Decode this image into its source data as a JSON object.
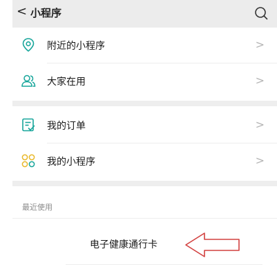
{
  "header": {
    "back_glyph": "<",
    "title": "小程序",
    "search_icon": "search-icon"
  },
  "list_group_1": [
    {
      "label": "附近的小程序",
      "icon": "location-pin-icon",
      "chevron": ">"
    },
    {
      "label": "大家在用",
      "icon": "people-icon",
      "chevron": ">"
    }
  ],
  "list_group_2": [
    {
      "label": "我的订单",
      "icon": "order-icon",
      "chevron": ">"
    },
    {
      "label": "我的小程序",
      "icon": "mini-program-icon",
      "chevron": ">"
    }
  ],
  "recent": {
    "section_label": "最近使用",
    "items": [
      {
        "label": "电子健康通行卡"
      }
    ]
  },
  "colors": {
    "accent_teal": "#16a59a",
    "arrow_red": "#d2403f",
    "header_bg": "#ececec",
    "chevron": "#b5b5b5"
  }
}
